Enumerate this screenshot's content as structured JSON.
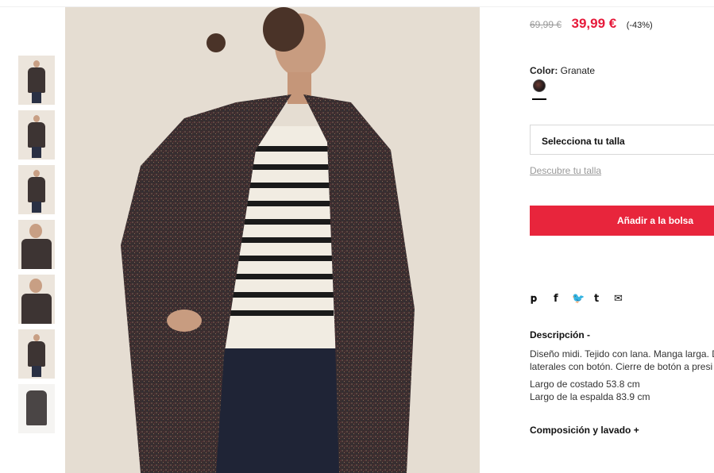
{
  "gallery": {
    "thumbnails": [
      {
        "label": "front"
      },
      {
        "label": "full-length"
      },
      {
        "label": "back"
      },
      {
        "label": "detail"
      },
      {
        "label": "portrait"
      },
      {
        "label": "side"
      },
      {
        "label": "flat-lay"
      }
    ]
  },
  "product": {
    "price_old": "69,99 €",
    "price_new": "39,99 €",
    "discount": "(-43%)",
    "color_label": "Color:",
    "color_value": "Granate",
    "size_placeholder": "Selecciona tu talla",
    "size_guide_link": "Descubre tu talla",
    "add_to_bag": "Añadir a la bolsa"
  },
  "share": {
    "icons": [
      "pinterest-icon",
      "facebook-icon",
      "twitter-icon",
      "tumblr-icon",
      "mail-icon"
    ]
  },
  "description": {
    "title": "Descripción -",
    "line1": "Diseño midi. Tejido con lana. Manga larga. D",
    "line2": "laterales con botón. Cierre de botón a presi",
    "measure1": "Largo de costado 53.8 cm",
    "measure2": "Largo de la espalda 83.9 cm"
  },
  "composition": {
    "title": "Composición y lavado +"
  },
  "colors": {
    "accent": "#e8253c",
    "sale_price": "#e6193a",
    "coat": "#3d3433",
    "background_photo": "#e5ddd2"
  }
}
